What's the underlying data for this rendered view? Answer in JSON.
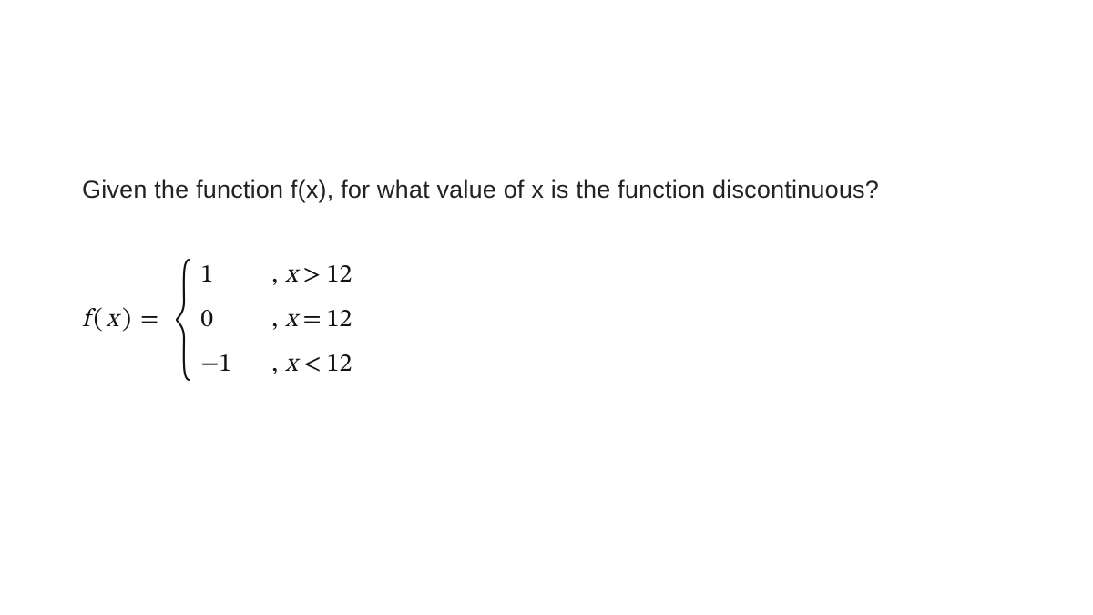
{
  "question": {
    "text": "Given the function f(x), for what value of x is the function discontinuous?"
  },
  "formula": {
    "lhs_f": "f",
    "lhs_open": "(",
    "lhs_x": "x",
    "lhs_close": ")",
    "eq": "=",
    "cases": [
      {
        "value": "1",
        "comma": ",",
        "var": "x",
        "rel": ">",
        "rhs": "12"
      },
      {
        "value": "0",
        "comma": ",",
        "var": "x",
        "rel": "=",
        "rhs": "12"
      },
      {
        "value": "−1",
        "comma": ",",
        "var": "x",
        "rel": "<",
        "rhs": "12"
      }
    ]
  }
}
